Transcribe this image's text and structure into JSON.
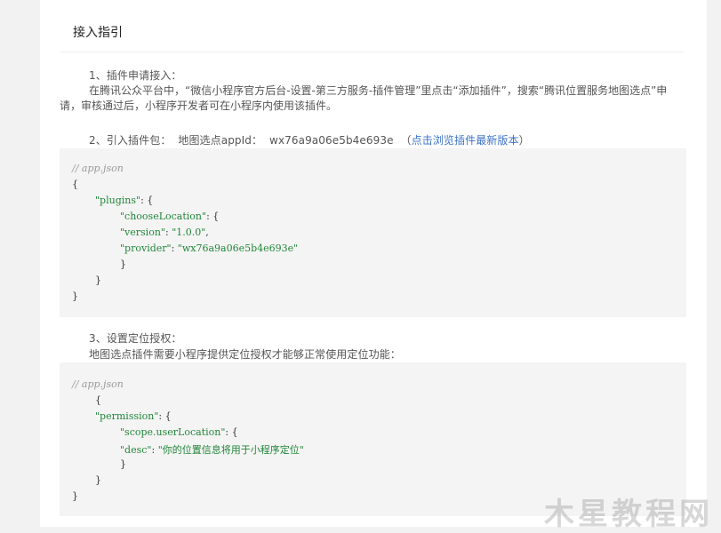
{
  "section": {
    "title": "接入指引"
  },
  "step1": {
    "heading": "1、插件申请接入：",
    "body": "在腾讯公众平台中，“微信小程序官方后台-设置-第三方服务-插件管理”里点击“添加插件”，搜索“腾讯位置服务地图选点”申请，审核通过后，小程序开发者可在小程序内使用该插件。"
  },
  "step2": {
    "heading": "2、引入插件包：",
    "appid_label": "地图选点appId：",
    "appid_value": "wx76a9a06e5b4e693e",
    "paren_open": "（",
    "link_text": "点击浏览插件最新版本",
    "paren_close": "）",
    "code": {
      "comment": "// app.json",
      "l1": "{",
      "l2_key": "\"plugins\"",
      "l2_rest": ": {",
      "l3_key": "\"chooseLocation\"",
      "l3_rest": ": {",
      "l4_key": "\"version\"",
      "l4_sep": ": ",
      "l4_val": "\"1.0.0\"",
      "l4_end": ",",
      "l5_key": "\"provider\"",
      "l5_sep": ": ",
      "l5_val": "\"wx76a9a06e5b4e693e\"",
      "l6": "}",
      "l7": "}",
      "l8": "}"
    }
  },
  "step3": {
    "heading": "3、设置定位授权：",
    "body": "地图选点插件需要小程序提供定位授权才能够正常使用定位功能：",
    "code": {
      "comment": "// app.json",
      "l1": "{",
      "l2_key": "\"permission\"",
      "l2_rest": ": {",
      "l3_key": "\"scope.userLocation\"",
      "l3_rest": ": {",
      "l4_key": "\"desc\"",
      "l4_sep": ": ",
      "l4_val": "\"你的位置信息将用于小程序定位\"",
      "l5": "}",
      "l6": "}",
      "l7": "}"
    }
  },
  "watermark": {
    "text": "木星教程网"
  },
  "colors": {
    "link": "#3b73c7",
    "code_bg": "#f4f4f4",
    "code_key": "#22863a",
    "comment": "#999999"
  }
}
